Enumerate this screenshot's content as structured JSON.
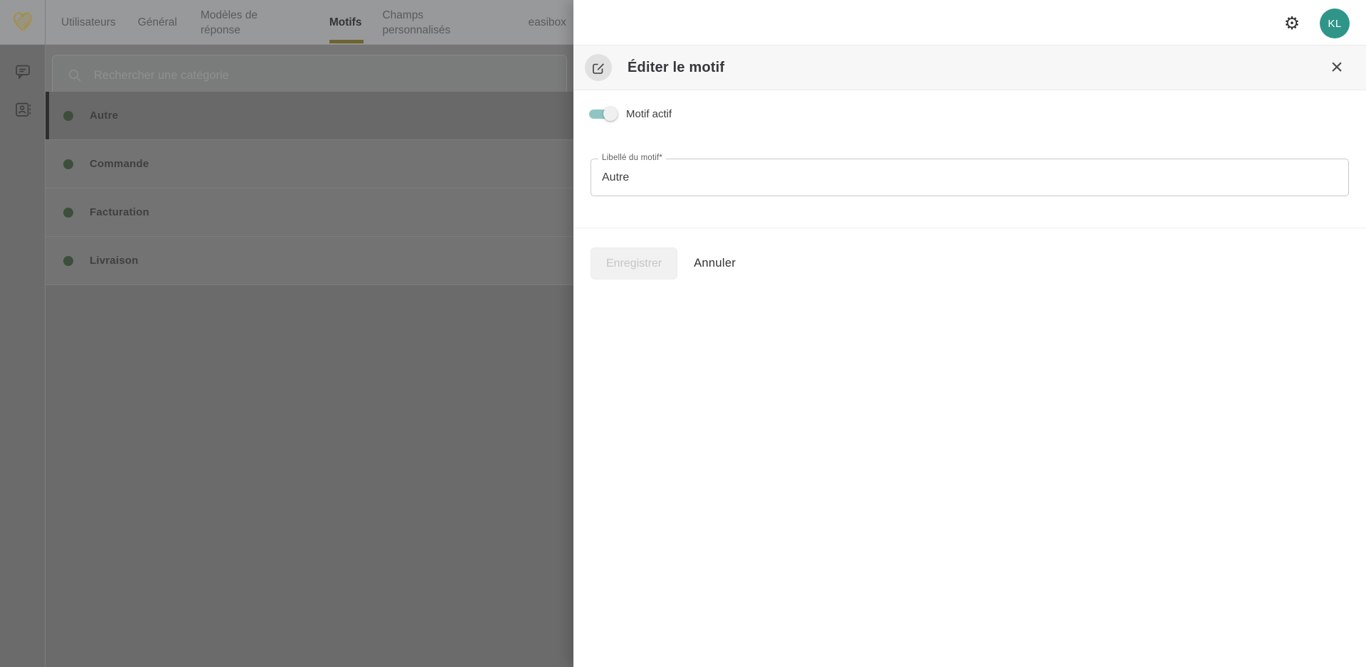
{
  "nav": {
    "tabs": [
      {
        "label": "Utilisateurs",
        "active": false
      },
      {
        "label": "Général",
        "active": false
      },
      {
        "label": "Modèles de réponse",
        "active": false
      },
      {
        "label": "Motifs",
        "active": true
      },
      {
        "label": "Champs personnalisés",
        "active": false
      },
      {
        "label": "easibox",
        "active": false
      }
    ]
  },
  "topbar": {
    "avatar_initials": "KL"
  },
  "search": {
    "placeholder": "Rechercher une catégorie"
  },
  "categories": [
    {
      "label": "Autre",
      "selected": true
    },
    {
      "label": "Commande",
      "selected": false
    },
    {
      "label": "Facturation",
      "selected": false
    },
    {
      "label": "Livraison",
      "selected": false
    }
  ],
  "drawer": {
    "title": "Éditer le motif",
    "toggle_label": "Motif actif",
    "toggle_on": true,
    "field_label": "Libellé du motif*",
    "field_value": "Autre",
    "save_label": "Enregistrer",
    "cancel_label": "Annuler",
    "close_glyph": "×",
    "gear_glyph": "⚙"
  },
  "colors": {
    "accent-gold": "#6f6430",
    "logo-gold": "#a89045",
    "dot-green": "#3c4f3a",
    "avatar-teal": "#2f9589",
    "toggle-teal": "#8fc6c4"
  }
}
